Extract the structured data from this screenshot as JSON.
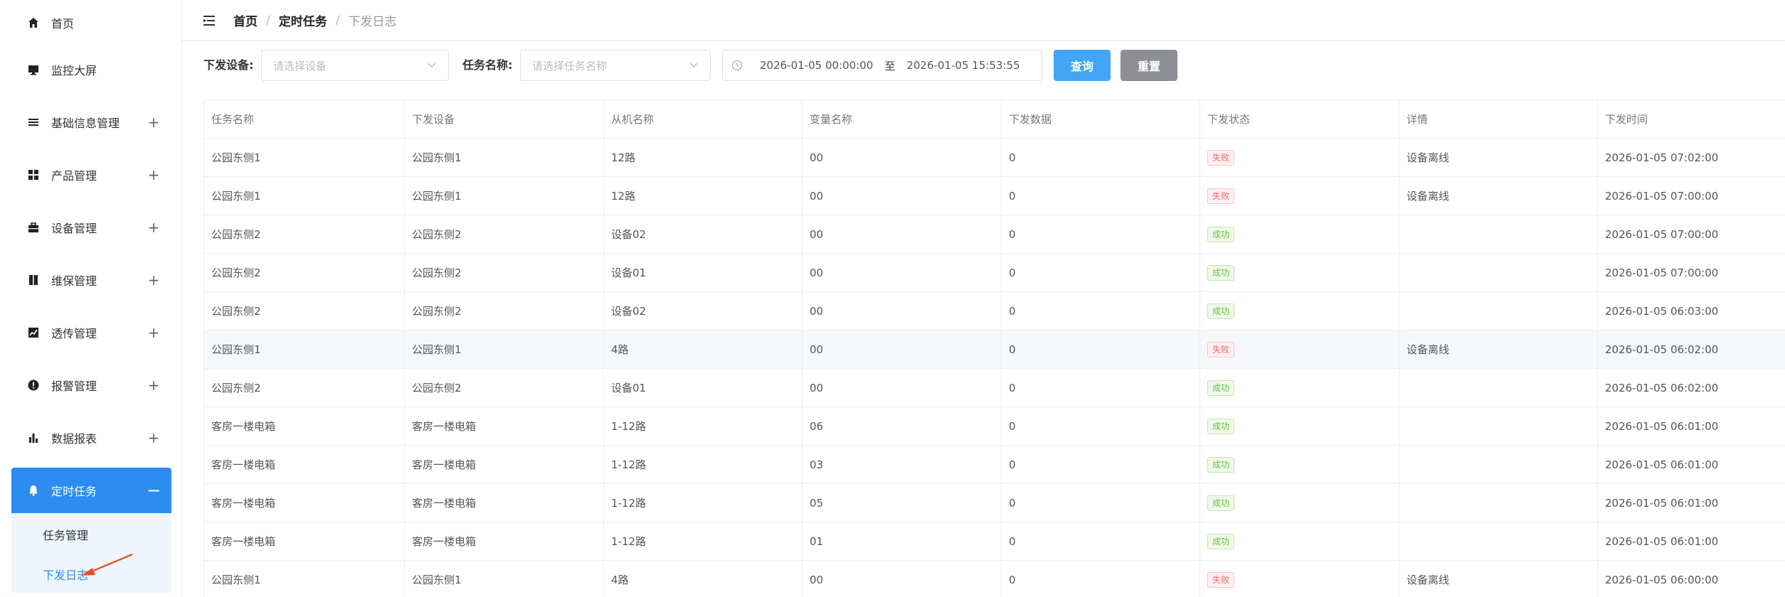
{
  "sidebar": {
    "items": [
      {
        "label": "首页",
        "icon": "home-icon",
        "expandable": false
      },
      {
        "label": "监控大屏",
        "icon": "monitor-icon",
        "expandable": false
      },
      {
        "label": "基础信息管理",
        "icon": "list-icon",
        "expandable": true
      },
      {
        "label": "产品管理",
        "icon": "grid-icon",
        "expandable": true
      },
      {
        "label": "设备管理",
        "icon": "briefcase-icon",
        "expandable": true
      },
      {
        "label": "维保管理",
        "icon": "book-icon",
        "expandable": true
      },
      {
        "label": "透传管理",
        "icon": "chart-line-icon",
        "expandable": true
      },
      {
        "label": "报警管理",
        "icon": "alert-icon",
        "expandable": true
      },
      {
        "label": "数据报表",
        "icon": "bar-chart-icon",
        "expandable": true
      },
      {
        "label": "定时任务",
        "icon": "bell-icon",
        "expandable": true,
        "active": true
      }
    ],
    "submenu": [
      {
        "label": "任务管理"
      },
      {
        "label": "下发日志",
        "active": true
      }
    ]
  },
  "breadcrumb": {
    "home": "首页",
    "section": "定时任务",
    "separator": "/",
    "current": "下发日志"
  },
  "filter": {
    "device_label": "下发设备:",
    "device_placeholder": "请选择设备",
    "task_label": "任务名称:",
    "task_placeholder": "请选择任务名称",
    "date_start": "2026-01-05 00:00:00",
    "date_to": "至",
    "date_end": "2026-01-05 15:53:55",
    "query_label": "查询",
    "reset_label": "重置"
  },
  "table": {
    "columns": [
      "任务名称",
      "下发设备",
      "从机名称",
      "变量名称",
      "下发数据",
      "下发状态",
      "详情",
      "下发时间"
    ],
    "rows": [
      {
        "task": "公园东侧1",
        "device": "公园东侧1",
        "slave": "12路",
        "variable": "00",
        "data": "0",
        "status": "失败",
        "status_type": "fail",
        "detail": "设备离线",
        "time": "2026-01-05 07:02:00"
      },
      {
        "task": "公园东侧1",
        "device": "公园东侧1",
        "slave": "12路",
        "variable": "00",
        "data": "0",
        "status": "失败",
        "status_type": "fail",
        "detail": "设备离线",
        "time": "2026-01-05 07:00:00"
      },
      {
        "task": "公园东侧2",
        "device": "公园东侧2",
        "slave": "设备02",
        "variable": "00",
        "data": "0",
        "status": "成功",
        "status_type": "ok",
        "detail": "",
        "time": "2026-01-05 07:00:00"
      },
      {
        "task": "公园东侧2",
        "device": "公园东侧2",
        "slave": "设备01",
        "variable": "00",
        "data": "0",
        "status": "成功",
        "status_type": "ok",
        "detail": "",
        "time": "2026-01-05 07:00:00"
      },
      {
        "task": "公园东侧2",
        "device": "公园东侧2",
        "slave": "设备02",
        "variable": "00",
        "data": "0",
        "status": "成功",
        "status_type": "ok",
        "detail": "",
        "time": "2026-01-05 06:03:00"
      },
      {
        "task": "公园东侧1",
        "device": "公园东侧1",
        "slave": "4路",
        "variable": "00",
        "data": "0",
        "status": "失败",
        "status_type": "fail",
        "detail": "设备离线",
        "time": "2026-01-05 06:02:00",
        "highlight": true
      },
      {
        "task": "公园东侧2",
        "device": "公园东侧2",
        "slave": "设备01",
        "variable": "00",
        "data": "0",
        "status": "成功",
        "status_type": "ok",
        "detail": "",
        "time": "2026-01-05 06:02:00"
      },
      {
        "task": "客房一楼电箱",
        "device": "客房一楼电箱",
        "slave": "1-12路",
        "variable": "06",
        "data": "0",
        "status": "成功",
        "status_type": "ok",
        "detail": "",
        "time": "2026-01-05 06:01:00"
      },
      {
        "task": "客房一楼电箱",
        "device": "客房一楼电箱",
        "slave": "1-12路",
        "variable": "03",
        "data": "0",
        "status": "成功",
        "status_type": "ok",
        "detail": "",
        "time": "2026-01-05 06:01:00"
      },
      {
        "task": "客房一楼电箱",
        "device": "客房一楼电箱",
        "slave": "1-12路",
        "variable": "05",
        "data": "0",
        "status": "成功",
        "status_type": "ok",
        "detail": "",
        "time": "2026-01-05 06:01:00"
      },
      {
        "task": "客房一楼电箱",
        "device": "客房一楼电箱",
        "slave": "1-12路",
        "variable": "01",
        "data": "0",
        "status": "成功",
        "status_type": "ok",
        "detail": "",
        "time": "2026-01-05 06:01:00"
      },
      {
        "task": "公园东侧1",
        "device": "公园东侧1",
        "slave": "4路",
        "variable": "00",
        "data": "0",
        "status": "失败",
        "status_type": "fail",
        "detail": "设备离线",
        "time": "2026-01-05 06:00:00"
      }
    ]
  },
  "colors": {
    "accent": "#2d8cf0",
    "query_button": "#42a5f5",
    "reset_button": "#8d8f94",
    "fail": "#f56c6c",
    "success": "#67c23a",
    "annotation_arrow": "#e8512e"
  }
}
